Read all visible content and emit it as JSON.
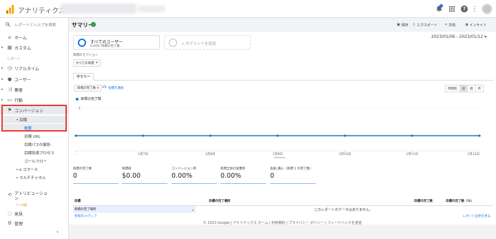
{
  "header": {
    "app_name": "アナリティクス",
    "icons": [
      "notifications-icon",
      "apps-icon",
      "help-icon",
      "more-vert-icon"
    ]
  },
  "sidebar": {
    "search_placeholder": "レポートとヘルプを検索",
    "items": [
      {
        "label": "ホーム",
        "icon": "home-icon"
      },
      {
        "label": "カスタム",
        "icon": "grid-icon"
      }
    ],
    "section_label": "レポート",
    "report_items": [
      {
        "label": "リアルタイム",
        "icon": "clock-icon"
      },
      {
        "label": "ユーザー",
        "icon": "person-icon"
      },
      {
        "label": "集客",
        "icon": "acquisition-icon"
      },
      {
        "label": "行動",
        "icon": "behavior-icon"
      },
      {
        "label": "コンバージョン",
        "icon": "flag-icon"
      }
    ],
    "goals": {
      "label": "目標",
      "sub": [
        "概要",
        "目標 URL",
        "目標パスの解析",
        "目標到達プロセス",
        "ゴールフロー"
      ]
    },
    "ecommerce": "e コマース",
    "multichannel": "マルチチャネル",
    "bottom": [
      {
        "label": "アトリビューション",
        "badge": "ベータ版",
        "icon": "attribution-icon"
      },
      {
        "label": "発見",
        "icon": "lightbulb-icon"
      },
      {
        "label": "管理",
        "icon": "gear-icon"
      }
    ]
  },
  "main": {
    "title": "サマリー",
    "toolbar": {
      "save": "保存",
      "export": "エクスポート",
      "share": "共有",
      "insight": "インサイト"
    },
    "segment_all": {
      "title": "すべてのユーザー",
      "subtitle": "0.00% 目標の完了数"
    },
    "segment_add": "+ セグメントを追加",
    "date_range": "2023/01/06 - 2023/01/12",
    "goal_option_label": "目標のオプション",
    "goal_option_value": "すべての目標",
    "tab_summary": "サマリー",
    "metric_select": "目標の完了数",
    "vs": "VS",
    "compare_link": "指標を選択",
    "period_buttons": [
      "時間別",
      "日",
      "週",
      "月"
    ],
    "active_period": "日",
    "table": {
      "col_goal": "目標",
      "col_location": "目標の完了場所",
      "col_completions": "目標の完了数",
      "col_pct": "目標の完了数（%）",
      "selected_row": "目標の完了場所",
      "row2": "参照元/メディア",
      "nodata": "このレポートのデータはありません。",
      "full_report": "レポート全体を見る"
    },
    "footer": "© 2023 Google | アナリティクス ホーム | 利用規約 | プライバシー ポリシー | フィードバックを送信"
  },
  "scorecards": [
    {
      "label": "目標の完了数",
      "value": "0"
    },
    {
      "label": "目標値",
      "value": "$0.00"
    },
    {
      "label": "コンバージョン率",
      "value": "0.00%"
    },
    {
      "label": "目標全体の放棄率",
      "value": "0.00%"
    },
    {
      "label": "会員_購入（目標 1 の完了数）",
      "value": "0"
    }
  ],
  "chart_data": {
    "type": "line",
    "title": "",
    "legend": "目標の完了数",
    "x": [
      "…",
      "1月7日",
      "1月8日",
      "1月9日",
      "1月10日",
      "1月11日",
      "1月12日"
    ],
    "series": [
      {
        "name": "目標の完了数",
        "values": [
          0,
          0,
          0,
          0,
          0,
          0,
          0
        ]
      }
    ],
    "y_ticks": [
      "1"
    ],
    "ylim": [
      0,
      1
    ],
    "color": "#1f77b4"
  }
}
